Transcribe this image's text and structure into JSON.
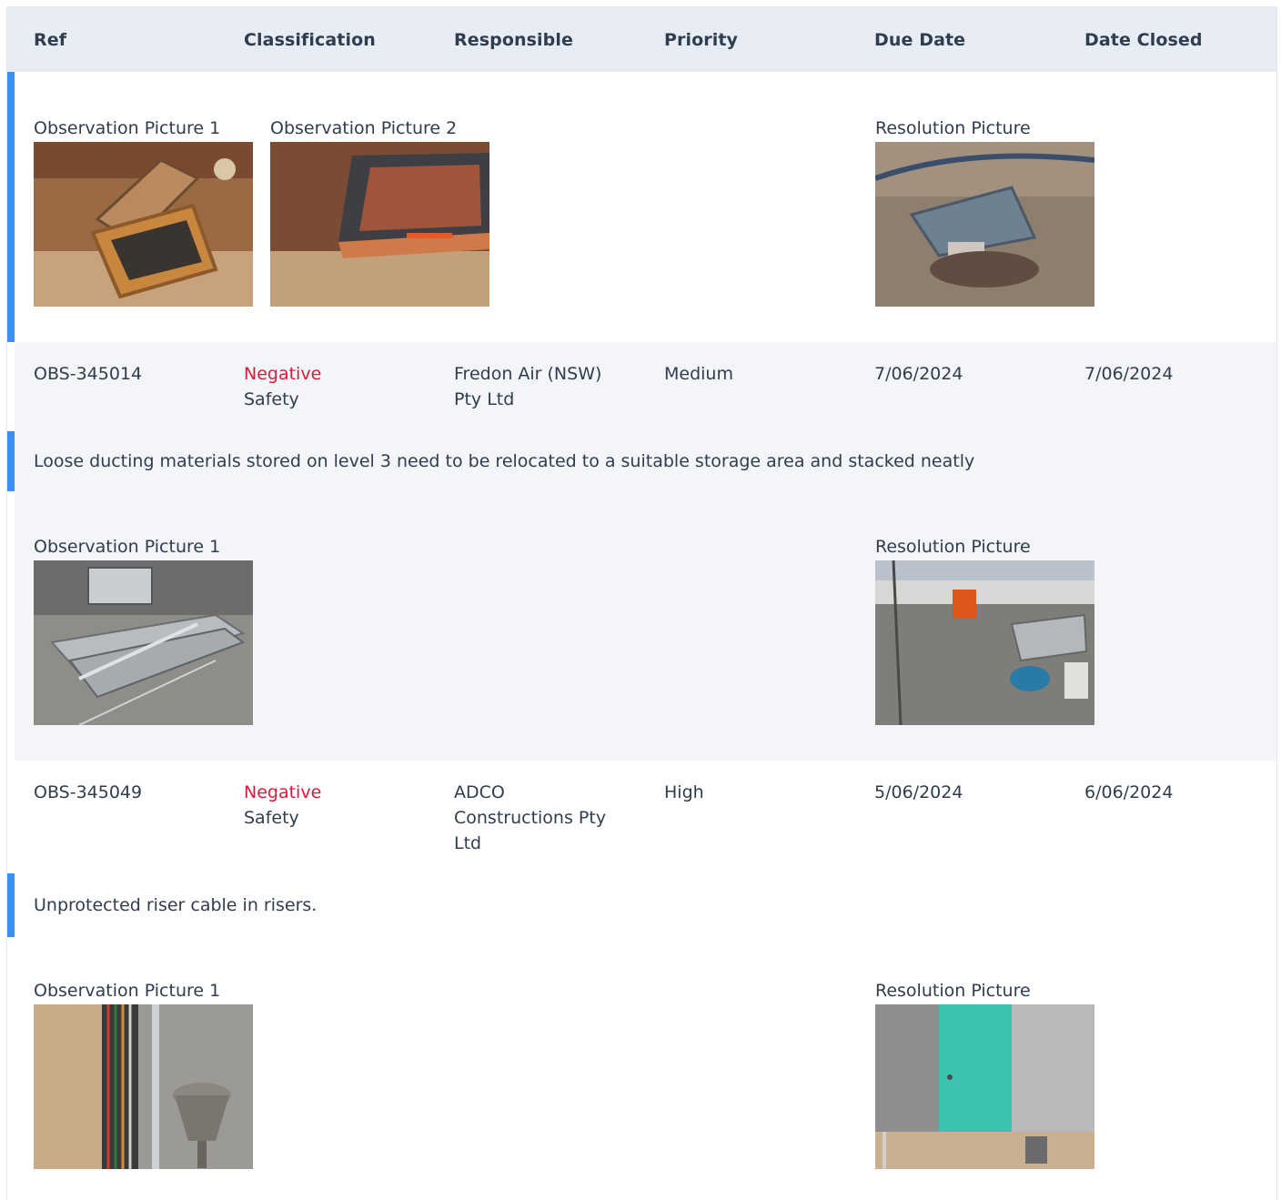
{
  "table": {
    "columns": {
      "ref": "Ref",
      "classification": "Classification",
      "responsible": "Responsible",
      "priority": "Priority",
      "due_date": "Due Date",
      "date_closed": "Date Closed"
    }
  },
  "record0": {
    "pictures": {
      "obs1_label": "Observation Picture 1",
      "obs2_label": "Observation Picture 2",
      "resolution_label": "Resolution Picture"
    }
  },
  "record1": {
    "ref": "OBS-345014",
    "classification_type": "Negative",
    "classification_category": "Safety",
    "responsible_line1": "Fredon Air (NSW)",
    "responsible_line2": "Pty Ltd",
    "priority": "Medium",
    "due_date": "7/06/2024",
    "date_closed": "7/06/2024",
    "description": "Loose ducting materials stored on level 3 need to be relocated to a suitable storage area and stacked neatly",
    "pictures": {
      "obs1_label": "Observation Picture 1",
      "resolution_label": "Resolution Picture"
    }
  },
  "record2": {
    "ref": "OBS-345049",
    "classification_type": "Negative",
    "classification_category": "Safety",
    "responsible_line1": "ADCO",
    "responsible_line2": "Constructions Pty",
    "responsible_line3": "Ltd",
    "priority": "High",
    "due_date": "5/06/2024",
    "date_closed": "6/06/2024",
    "description": "Unprotected riser cable in risers.",
    "pictures": {
      "obs1_label": "Observation Picture 1",
      "resolution_label": "Resolution Picture"
    }
  },
  "colors": {
    "accent": "#3b8ff0",
    "negative": "#e3163a",
    "header_bg": "#e8edf5",
    "row_alt_bg": "#f3f5f8"
  },
  "icons": {
    "photo_thumbnails": "photo"
  }
}
